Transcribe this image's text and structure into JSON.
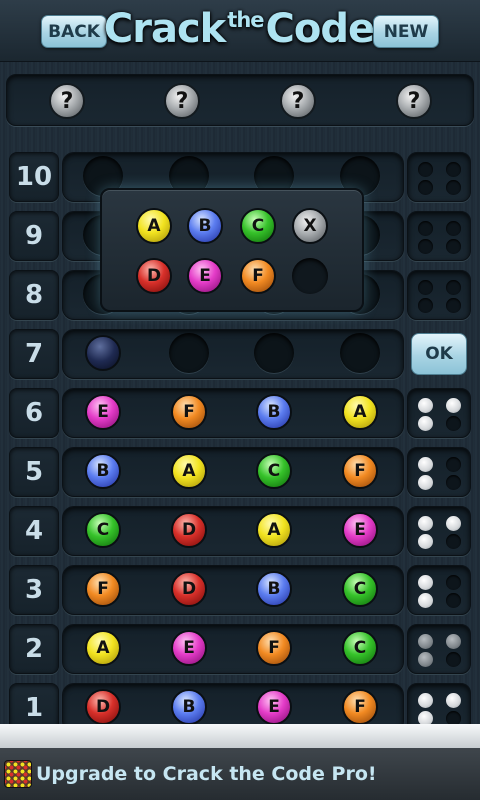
{
  "header": {
    "back_label": "BACK",
    "new_label": "NEW",
    "title_part1": "Crack",
    "title_part2": "the",
    "title_part3": "Code"
  },
  "secret_code": [
    "?",
    "?",
    "?",
    "?"
  ],
  "palette": {
    "row1": [
      "A",
      "B",
      "C",
      "X"
    ],
    "row2": [
      "D",
      "E",
      "F"
    ]
  },
  "colors": {
    "A": "#f2e320",
    "B": "#5c7df0",
    "C": "#36c22a",
    "D": "#d8302a",
    "E": "#e43cc8",
    "F": "#f28a22"
  },
  "ok_label": "OK",
  "rows": [
    {
      "num": "10",
      "pegs": [],
      "feedback": [
        "empty",
        "empty",
        "empty",
        "empty"
      ]
    },
    {
      "num": "9",
      "pegs": [],
      "feedback": [
        "empty",
        "empty",
        "empty",
        "empty"
      ]
    },
    {
      "num": "8",
      "pegs": [],
      "feedback": [
        "empty",
        "empty",
        "empty",
        "empty"
      ]
    },
    {
      "num": "7",
      "pegs": [
        "current"
      ],
      "feedback": []
    },
    {
      "num": "6",
      "pegs": [
        "E",
        "F",
        "B",
        "A"
      ],
      "feedback": [
        "white",
        "white",
        "white",
        "empty"
      ]
    },
    {
      "num": "5",
      "pegs": [
        "B",
        "A",
        "C",
        "F"
      ],
      "feedback": [
        "white",
        "empty",
        "white",
        "empty"
      ]
    },
    {
      "num": "4",
      "pegs": [
        "C",
        "D",
        "A",
        "E"
      ],
      "feedback": [
        "white",
        "white",
        "white",
        "empty"
      ]
    },
    {
      "num": "3",
      "pegs": [
        "F",
        "D",
        "B",
        "C"
      ],
      "feedback": [
        "white",
        "empty",
        "white",
        "empty"
      ]
    },
    {
      "num": "2",
      "pegs": [
        "A",
        "E",
        "F",
        "C"
      ],
      "feedback": [
        "gray",
        "gray",
        "gray",
        "empty"
      ]
    },
    {
      "num": "1",
      "pegs": [
        "D",
        "B",
        "E",
        "F"
      ],
      "feedback": [
        "white",
        "white",
        "white",
        "empty"
      ]
    }
  ],
  "banner_text": "Upgrade to Crack the Code Pro!",
  "icons": {
    "banner": "game-board-icon"
  }
}
